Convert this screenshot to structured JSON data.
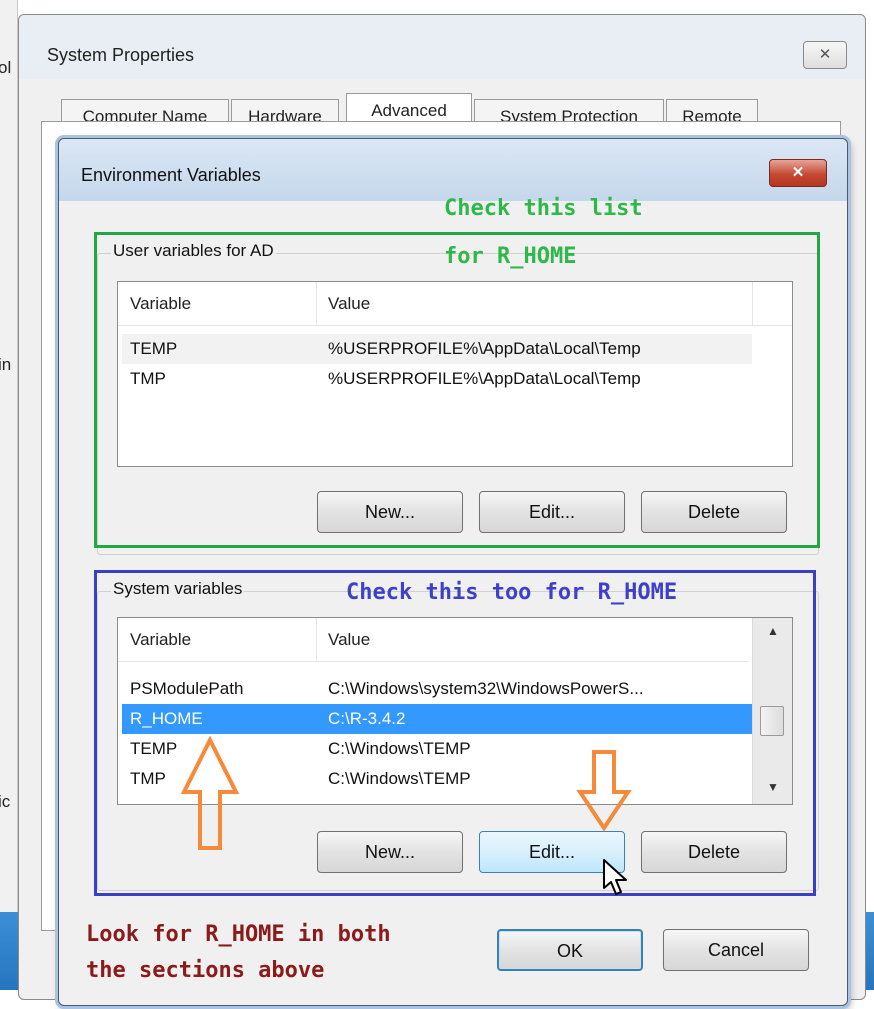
{
  "background": {
    "left_fragment_top": "ol",
    "left_fragment_mid": "in",
    "left_fragment_low": "ic"
  },
  "system_properties": {
    "title": "System Properties",
    "close_glyph": "✕",
    "tabs": [
      {
        "label": "Computer Name"
      },
      {
        "label": "Hardware"
      },
      {
        "label": "Advanced"
      },
      {
        "label": "System Protection"
      },
      {
        "label": "Remote"
      }
    ]
  },
  "env_dialog": {
    "title": "Environment Variables",
    "close_glyph": "✕",
    "user_group": {
      "label": "User variables for AD",
      "columns": [
        "Variable",
        "Value"
      ],
      "rows": [
        {
          "variable": "TEMP",
          "value": "%USERPROFILE%\\AppData\\Local\\Temp"
        },
        {
          "variable": "TMP",
          "value": "%USERPROFILE%\\AppData\\Local\\Temp"
        }
      ],
      "buttons": {
        "new": "New...",
        "edit": "Edit...",
        "delete": "Delete"
      }
    },
    "system_group": {
      "label": "System variables",
      "columns": [
        "Variable",
        "Value"
      ],
      "rows": [
        {
          "variable": "PSModulePath",
          "value": "C:\\Windows\\system32\\WindowsPowerS..."
        },
        {
          "variable": "R_HOME",
          "value": "C:\\R-3.4.2"
        },
        {
          "variable": "TEMP",
          "value": "C:\\Windows\\TEMP"
        },
        {
          "variable": "TMP",
          "value": "C:\\Windows\\TEMP"
        }
      ],
      "selected_variable": "R_HOME",
      "buttons": {
        "new": "New...",
        "edit": "Edit...",
        "delete": "Delete"
      }
    },
    "ok_label": "OK",
    "cancel_label": "Cancel"
  },
  "annotations": {
    "green_line1": "Check this list",
    "green_line2": "for R_HOME",
    "blue_text": "Check this too for R_HOME",
    "red_line1": "Look for R_HOME in both",
    "red_line2": "the sections above"
  },
  "colors": {
    "selection": "#3399ff",
    "annotation_green": "#22a744",
    "annotation_blue": "#3a3fc4",
    "annotation_red": "#8b1a1a",
    "arrow_orange": "#f58a3a"
  }
}
